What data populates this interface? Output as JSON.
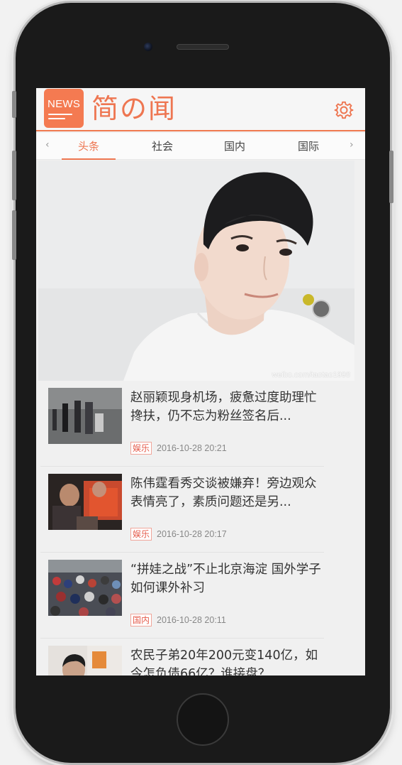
{
  "app": {
    "logo_text": "NEWS",
    "title": "简の闻"
  },
  "tabs": {
    "prev_arrow": "‹",
    "next_arrow": "›",
    "items": [
      {
        "label": "头条",
        "active": true
      },
      {
        "label": "社会",
        "active": false
      },
      {
        "label": "国内",
        "active": false
      },
      {
        "label": "国际",
        "active": false
      }
    ]
  },
  "hero": {
    "watermark": "weibo.com/taotao1998"
  },
  "news": [
    {
      "title": "赵丽颖现身机场，疲惫过度助理忙搀扶，仍不忘为粉丝签名后...",
      "category": "娱乐",
      "time": "2016-10-28 20:21"
    },
    {
      "title": "陈伟霆看秀交谈被嫌弃！旁边观众表情亮了，素质问题还是另...",
      "category": "娱乐",
      "time": "2016-10-28 20:17"
    },
    {
      "title": "“拼娃之战”不止北京海淀 国外学子如何课外补习",
      "category": "国内",
      "time": "2016-10-28 20:11"
    },
    {
      "title": "农民子弟20年200元变140亿，如今怎负债66亿？谁接盘？",
      "category": "",
      "time": ""
    }
  ],
  "colors": {
    "accent": "#ee7651",
    "badge_text": "#e55b4b"
  },
  "icons": {
    "settings": "gear-icon",
    "prev": "chevron-left-icon",
    "next": "chevron-right-icon"
  }
}
